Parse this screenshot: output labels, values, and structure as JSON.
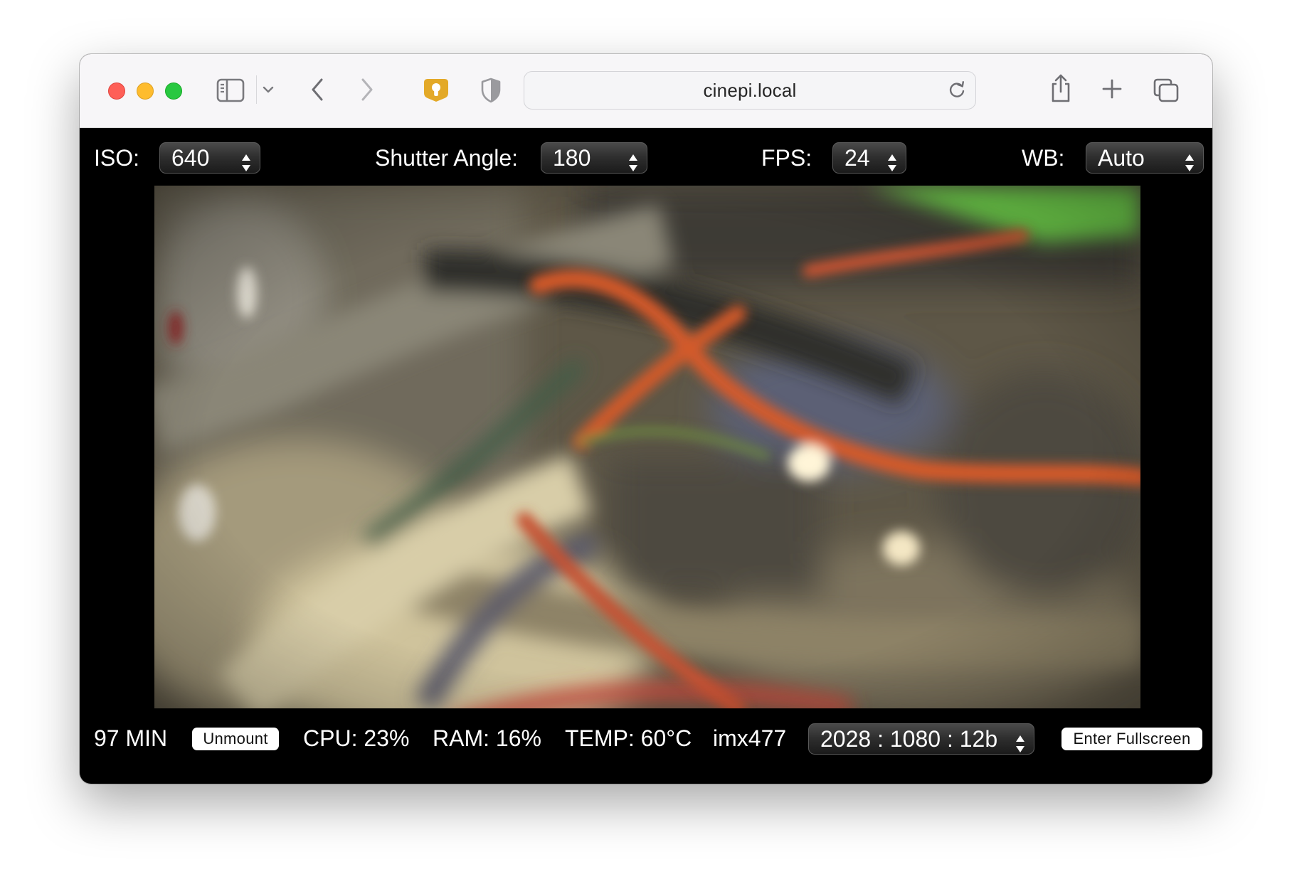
{
  "browser": {
    "url": "cinepi.local",
    "icons": {
      "sidebar": "sidebar-icon",
      "chevron": "chevron-down-icon",
      "back": "back-arrow-icon",
      "forward": "forward-arrow-icon",
      "password_manager": "keyhole-icon",
      "privacy": "shield-icon",
      "reload": "reload-icon",
      "share": "share-icon",
      "new_tab": "plus-icon",
      "tabs": "tabs-overview-icon"
    }
  },
  "controls": {
    "iso": {
      "label": "ISO:",
      "value": "640"
    },
    "shutter": {
      "label": "Shutter Angle:",
      "value": "180"
    },
    "fps": {
      "label": "FPS:",
      "value": "24"
    },
    "wb": {
      "label": "WB:",
      "value": "Auto"
    }
  },
  "status": {
    "remaining": "97 MIN",
    "unmount_label": "Unmount",
    "cpu": "CPU: 23%",
    "ram": "RAM: 16%",
    "temp": "TEMP: 60°C",
    "sensor": "imx477",
    "mode": "2028 : 1080 : 12b",
    "fullscreen_label": "Enter Fullscreen"
  },
  "colors": {
    "traffic_close": "#fe5f57",
    "traffic_minimize": "#febc2e",
    "traffic_maximize": "#28c840",
    "password_icon": "#e3a928",
    "app_background": "#000000"
  }
}
